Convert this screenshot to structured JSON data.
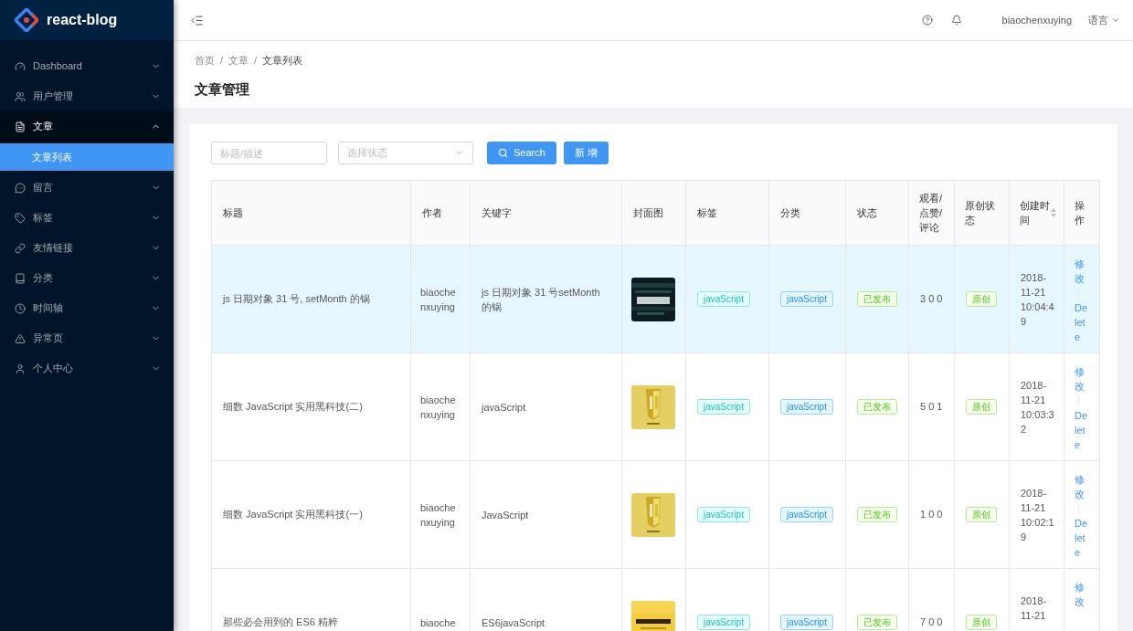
{
  "brand": "react-blog",
  "menu": [
    {
      "label": "Dashboard",
      "expanded": false
    },
    {
      "label": "用户管理",
      "expanded": false
    },
    {
      "label": "文章",
      "expanded": true,
      "children": [
        {
          "label": "文章列表",
          "selected": true
        }
      ]
    },
    {
      "label": "留言",
      "expanded": false
    },
    {
      "label": "标签",
      "expanded": false
    },
    {
      "label": "友情链接",
      "expanded": false
    },
    {
      "label": "分类",
      "expanded": false
    },
    {
      "label": "时间轴",
      "expanded": false
    },
    {
      "label": "异常页",
      "expanded": false
    },
    {
      "label": "个人中心",
      "expanded": false
    }
  ],
  "header": {
    "username": "biaochenxuying",
    "language": "语言"
  },
  "breadcrumb": {
    "separator": "/",
    "items": [
      "首页",
      "文章",
      "文章列表"
    ]
  },
  "page_title": "文章管理",
  "filters": {
    "search_placeholder": "标题/描述",
    "status_placeholder": "选择状态",
    "search_button": "Search",
    "add_button": "新 增"
  },
  "table": {
    "columns": [
      "标题",
      "作者",
      "关键字",
      "封面图",
      "标签",
      "分类",
      "状态",
      "观看/点赞/评论",
      "原创状态",
      "创建时间",
      "操作"
    ],
    "rows": [
      {
        "selected": true,
        "title": "js 日期对象 31 号, setMonth 的锅",
        "author": "biaochenxuying",
        "keywords": "js 日期对象 31 号setMonth 的锅",
        "cover": {
          "kind": "picture"
        },
        "tags": [
          "javaScript"
        ],
        "category": "javaScript",
        "status": "已发布",
        "stats": "3 0 0",
        "origin": "原创",
        "created": "2018-11-21 10:04:49",
        "actions": [
          "修改",
          "Delete"
        ]
      },
      {
        "selected": false,
        "title": "细数 JavaScript 实用黑科技(二)",
        "author": "biaochenxuying",
        "keywords": "javaScript",
        "cover": {
          "kind": "picture"
        },
        "tags": [
          "javaScript"
        ],
        "category": "javaScript",
        "status": "已发布",
        "stats": "5 0 1",
        "origin": "原创",
        "created": "2018-11-21 10:03:32",
        "actions": [
          "修改",
          "Delete"
        ]
      },
      {
        "selected": false,
        "title": "细数 JavaScript 实用黑科技(一)",
        "author": "biaochenxuying",
        "keywords": "JavaScript",
        "cover": {
          "kind": "picture"
        },
        "tags": [
          "javaScript"
        ],
        "category": "javaScript",
        "status": "已发布",
        "stats": "1 0 0",
        "origin": "原创",
        "created": "2018-11-21 10:02:19",
        "actions": [
          "修改",
          "Delete"
        ]
      },
      {
        "selected": false,
        "title": "那些必会用到的 ES6 精粹",
        "author": "biaoche",
        "keywords": "ES6javaScript",
        "cover": {
          "kind": "picture"
        },
        "tags": [
          "javaScript"
        ],
        "category": "javaScript",
        "status": "已发布",
        "stats": "7 0 0",
        "origin": "原创",
        "created": "2018-11-21",
        "actions": [
          "修改"
        ]
      }
    ]
  }
}
